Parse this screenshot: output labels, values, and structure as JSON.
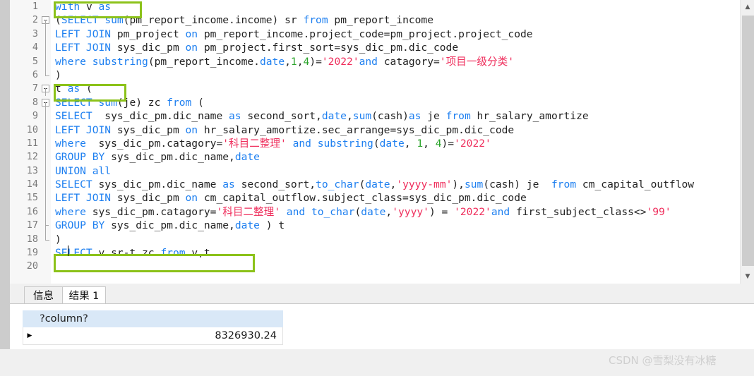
{
  "window": {
    "scrollbar": {
      "up_arrow": "▲",
      "down_arrow": "▼"
    }
  },
  "editor": {
    "lines": [
      {
        "n": "1",
        "fold": "none",
        "tokens": [
          {
            "t": "kw",
            "v": "with"
          },
          {
            "t": "plain",
            "v": " v "
          },
          {
            "t": "kw",
            "v": "as"
          }
        ]
      },
      {
        "n": "2",
        "fold": "box",
        "tokens": [
          {
            "t": "plain",
            "v": "("
          },
          {
            "t": "kw",
            "v": "SELECT"
          },
          {
            "t": "plain",
            "v": " "
          },
          {
            "t": "kw",
            "v": "sum"
          },
          {
            "t": "plain",
            "v": "(pm_report_income.income) sr "
          },
          {
            "t": "kw",
            "v": "from"
          },
          {
            "t": "plain",
            "v": " pm_report_income"
          }
        ]
      },
      {
        "n": "3",
        "fold": "line",
        "tokens": [
          {
            "t": "kw",
            "v": "LEFT JOIN"
          },
          {
            "t": "plain",
            "v": " pm_project "
          },
          {
            "t": "kw",
            "v": "on"
          },
          {
            "t": "plain",
            "v": " pm_report_income.project_code=pm_project.project_code"
          }
        ]
      },
      {
        "n": "4",
        "fold": "line",
        "tokens": [
          {
            "t": "kw",
            "v": "LEFT JOIN"
          },
          {
            "t": "plain",
            "v": " sys_dic_pm "
          },
          {
            "t": "kw",
            "v": "on"
          },
          {
            "t": "plain",
            "v": " pm_project.first_sort=sys_dic_pm.dic_code"
          }
        ]
      },
      {
        "n": "5",
        "fold": "line",
        "tokens": [
          {
            "t": "kw",
            "v": "where"
          },
          {
            "t": "plain",
            "v": " "
          },
          {
            "t": "kw",
            "v": "substring"
          },
          {
            "t": "plain",
            "v": "(pm_report_income."
          },
          {
            "t": "kw",
            "v": "date"
          },
          {
            "t": "plain",
            "v": ","
          },
          {
            "t": "num",
            "v": "1"
          },
          {
            "t": "plain",
            "v": ","
          },
          {
            "t": "num",
            "v": "4"
          },
          {
            "t": "plain",
            "v": ")="
          },
          {
            "t": "str",
            "v": "'2022'"
          },
          {
            "t": "kw",
            "v": "and"
          },
          {
            "t": "plain",
            "v": " catagory="
          },
          {
            "t": "str",
            "v": "'项目一级分类'"
          }
        ]
      },
      {
        "n": "6",
        "fold": "elbow",
        "tokens": [
          {
            "t": "plain",
            "v": ")"
          }
        ]
      },
      {
        "n": "7",
        "fold": "box",
        "tokens": [
          {
            "t": "plain",
            "v": "t "
          },
          {
            "t": "kw",
            "v": "as"
          },
          {
            "t": "plain",
            "v": " ("
          }
        ]
      },
      {
        "n": "8",
        "fold": "box",
        "tokens": [
          {
            "t": "kw",
            "v": "SELECT"
          },
          {
            "t": "plain",
            "v": " "
          },
          {
            "t": "kw",
            "v": "sum"
          },
          {
            "t": "plain",
            "v": "(je) zc "
          },
          {
            "t": "kw",
            "v": "from"
          },
          {
            "t": "plain",
            "v": " ("
          }
        ]
      },
      {
        "n": "9",
        "fold": "line",
        "tokens": [
          {
            "t": "kw",
            "v": "SELECT"
          },
          {
            "t": "plain",
            "v": "  sys_dic_pm.dic_name "
          },
          {
            "t": "kw",
            "v": "as"
          },
          {
            "t": "plain",
            "v": " second_sort,"
          },
          {
            "t": "kw",
            "v": "date"
          },
          {
            "t": "plain",
            "v": ","
          },
          {
            "t": "kw",
            "v": "sum"
          },
          {
            "t": "plain",
            "v": "(cash)"
          },
          {
            "t": "kw",
            "v": "as"
          },
          {
            "t": "plain",
            "v": " je "
          },
          {
            "t": "kw",
            "v": "from"
          },
          {
            "t": "plain",
            "v": " hr_salary_amortize"
          }
        ]
      },
      {
        "n": "10",
        "fold": "line",
        "tokens": [
          {
            "t": "kw",
            "v": "LEFT JOIN"
          },
          {
            "t": "plain",
            "v": " sys_dic_pm "
          },
          {
            "t": "kw",
            "v": "on"
          },
          {
            "t": "plain",
            "v": " hr_salary_amortize.sec_arrange=sys_dic_pm.dic_code"
          }
        ]
      },
      {
        "n": "11",
        "fold": "line",
        "tokens": [
          {
            "t": "kw",
            "v": "where"
          },
          {
            "t": "plain",
            "v": "  sys_dic_pm.catagory="
          },
          {
            "t": "str",
            "v": "'科目二整理'"
          },
          {
            "t": "plain",
            "v": " "
          },
          {
            "t": "kw",
            "v": "and"
          },
          {
            "t": "plain",
            "v": " "
          },
          {
            "t": "kw",
            "v": "substring"
          },
          {
            "t": "plain",
            "v": "("
          },
          {
            "t": "kw",
            "v": "date"
          },
          {
            "t": "plain",
            "v": ", "
          },
          {
            "t": "num",
            "v": "1"
          },
          {
            "t": "plain",
            "v": ", "
          },
          {
            "t": "num",
            "v": "4"
          },
          {
            "t": "plain",
            "v": ")="
          },
          {
            "t": "str",
            "v": "'2022'"
          }
        ]
      },
      {
        "n": "12",
        "fold": "line",
        "tokens": [
          {
            "t": "kw",
            "v": "GROUP BY"
          },
          {
            "t": "plain",
            "v": " sys_dic_pm.dic_name,"
          },
          {
            "t": "kw",
            "v": "date"
          }
        ]
      },
      {
        "n": "13",
        "fold": "line",
        "tokens": [
          {
            "t": "kw",
            "v": "UNION all"
          }
        ]
      },
      {
        "n": "14",
        "fold": "line",
        "tokens": [
          {
            "t": "kw",
            "v": "SELECT"
          },
          {
            "t": "plain",
            "v": " sys_dic_pm.dic_name "
          },
          {
            "t": "kw",
            "v": "as"
          },
          {
            "t": "plain",
            "v": " second_sort,"
          },
          {
            "t": "kw",
            "v": "to_char"
          },
          {
            "t": "plain",
            "v": "("
          },
          {
            "t": "kw",
            "v": "date"
          },
          {
            "t": "plain",
            "v": ","
          },
          {
            "t": "str",
            "v": "'yyyy-mm'"
          },
          {
            "t": "plain",
            "v": "),"
          },
          {
            "t": "kw",
            "v": "sum"
          },
          {
            "t": "plain",
            "v": "(cash) je  "
          },
          {
            "t": "kw",
            "v": "from"
          },
          {
            "t": "plain",
            "v": " cm_capital_outflow"
          }
        ]
      },
      {
        "n": "15",
        "fold": "line",
        "tokens": [
          {
            "t": "kw",
            "v": "LEFT JOIN"
          },
          {
            "t": "plain",
            "v": " sys_dic_pm "
          },
          {
            "t": "kw",
            "v": "on"
          },
          {
            "t": "plain",
            "v": " cm_capital_outflow.subject_class=sys_dic_pm.dic_code"
          }
        ]
      },
      {
        "n": "16",
        "fold": "line",
        "tokens": [
          {
            "t": "kw",
            "v": "where"
          },
          {
            "t": "plain",
            "v": " sys_dic_pm.catagory="
          },
          {
            "t": "str",
            "v": "'科目二整理'"
          },
          {
            "t": "plain",
            "v": " "
          },
          {
            "t": "kw",
            "v": "and"
          },
          {
            "t": "plain",
            "v": " "
          },
          {
            "t": "kw",
            "v": "to_char"
          },
          {
            "t": "plain",
            "v": "("
          },
          {
            "t": "kw",
            "v": "date"
          },
          {
            "t": "plain",
            "v": ","
          },
          {
            "t": "str",
            "v": "'yyyy'"
          },
          {
            "t": "plain",
            "v": ") = "
          },
          {
            "t": "str",
            "v": "'2022'"
          },
          {
            "t": "kw",
            "v": "and"
          },
          {
            "t": "plain",
            "v": " first_subject_class<>"
          },
          {
            "t": "str",
            "v": "'99'"
          }
        ]
      },
      {
        "n": "17",
        "fold": "tick",
        "tokens": [
          {
            "t": "kw",
            "v": "GROUP BY"
          },
          {
            "t": "plain",
            "v": " sys_dic_pm.dic_name,"
          },
          {
            "t": "kw",
            "v": "date"
          },
          {
            "t": "plain",
            "v": " ) t"
          }
        ]
      },
      {
        "n": "18",
        "fold": "elbow",
        "tokens": [
          {
            "t": "plain",
            "v": ") "
          }
        ]
      },
      {
        "n": "19",
        "fold": "none",
        "tokens": [
          {
            "t": "kw",
            "v": "SELECT"
          },
          {
            "t": "plain",
            "v": " v.sr-t.zc "
          },
          {
            "t": "kw",
            "v": "from"
          },
          {
            "t": "plain",
            "v": " v,t"
          }
        ]
      },
      {
        "n": "20",
        "fold": "none",
        "tokens": []
      }
    ]
  },
  "bottom_panel": {
    "tabs": [
      {
        "label": "信息",
        "active": false
      },
      {
        "label": "结果 1",
        "active": true
      }
    ],
    "result_grid": {
      "columns": [
        "?column?"
      ],
      "rows": [
        {
          "selector": "▶",
          "values": [
            "8326930.24"
          ]
        }
      ]
    }
  },
  "watermark": {
    "text": "CSDN @雪梨没有冰糖"
  }
}
